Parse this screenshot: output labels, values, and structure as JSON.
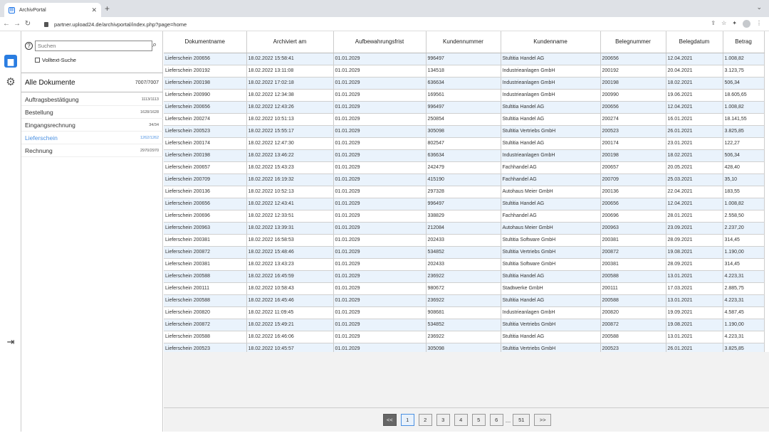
{
  "browser": {
    "tab_title": "ArchivPortal",
    "url": "partner.upload24.de/archivportal/index.php?page=home"
  },
  "sidebar": {
    "search_placeholder": "Suchen",
    "fulltext_label": "Volltext-Suche",
    "all": {
      "label": "Alle Dokumente",
      "count": "7007/7007"
    },
    "categories": [
      {
        "label": "Auftragsbestätigung",
        "count": "1113/1113"
      },
      {
        "label": "Bestellung",
        "count": "1628/1628"
      },
      {
        "label": "Eingangsrechnung",
        "count": "34/34"
      },
      {
        "label": "Lieferschein",
        "count": "1262/1262"
      },
      {
        "label": "Rechnung",
        "count": "2970/2970"
      }
    ]
  },
  "table": {
    "columns": [
      "Dokumentname",
      "Archiviert am",
      "Aufbewahrungsfrist",
      "Kundennummer",
      "Kundenname",
      "Belegnummer",
      "Belegdatum",
      "Betrag"
    ],
    "rows": [
      [
        "Lieferschein 200656",
        "18.02.2022 15:58:41",
        "01.01.2029",
        "996497",
        "Stultitia Handel AG",
        "200656",
        "12.04.2021",
        "1.008,82"
      ],
      [
        "Lieferschein 200192",
        "18.02.2022 13:11:08",
        "01.01.2029",
        "134518",
        "Industrieanlagen GmbH",
        "200192",
        "20.04.2021",
        "3.123,75"
      ],
      [
        "Lieferschein 200198",
        "18.02.2022 17:02:18",
        "01.01.2029",
        "636634",
        "Industrieanlagen GmbH",
        "200198",
        "18.02.2021",
        "506,34"
      ],
      [
        "Lieferschein 200990",
        "18.02.2022 12:34:38",
        "01.01.2029",
        "169561",
        "Industrieanlagen GmbH",
        "200990",
        "19.06.2021",
        "18.605,65"
      ],
      [
        "Lieferschein 200656",
        "18.02.2022 12:43:26",
        "01.01.2029",
        "996497",
        "Stultitia Handel AG",
        "200656",
        "12.04.2021",
        "1.008,82"
      ],
      [
        "Lieferschein 200274",
        "18.02.2022 10:51:13",
        "01.01.2029",
        "250854",
        "Stultitia Handel AG",
        "200274",
        "16.01.2021",
        "18.141,55"
      ],
      [
        "Lieferschein 200523",
        "18.02.2022 15:55:17",
        "01.01.2029",
        "305098",
        "Stultitia Vertriebs GmbH",
        "200523",
        "26.01.2021",
        "3.825,85"
      ],
      [
        "Lieferschein 200174",
        "18.02.2022 12:47:30",
        "01.01.2029",
        "802547",
        "Stultitia Handel AG",
        "200174",
        "23.01.2021",
        "122,27"
      ],
      [
        "Lieferschein 200198",
        "18.02.2022 13:46:22",
        "01.01.2029",
        "636634",
        "Industrieanlagen GmbH",
        "200198",
        "18.02.2021",
        "506,34"
      ],
      [
        "Lieferschein 200657",
        "18.02.2022 15:43:23",
        "01.01.2029",
        "242479",
        "Fachhandel AG",
        "200657",
        "20.05.2021",
        "428,40"
      ],
      [
        "Lieferschein 200709",
        "18.02.2022 16:19:32",
        "01.01.2029",
        "415190",
        "Fachhandel AG",
        "200709",
        "25.03.2021",
        "35,10"
      ],
      [
        "Lieferschein 200136",
        "18.02.2022 10:52:13",
        "01.01.2029",
        "297328",
        "Autohaus Meier GmbH",
        "200136",
        "22.04.2021",
        "183,55"
      ],
      [
        "Lieferschein 200656",
        "18.02.2022 12:43:41",
        "01.01.2029",
        "996497",
        "Stultitia Handel AG",
        "200656",
        "12.04.2021",
        "1.008,82"
      ],
      [
        "Lieferschein 200696",
        "18.02.2022 12:33:51",
        "01.01.2029",
        "338829",
        "Fachhandel AG",
        "200696",
        "28.01.2021",
        "2.558,50"
      ],
      [
        "Lieferschein 200963",
        "18.02.2022 13:39:31",
        "01.01.2029",
        "212084",
        "Autohaus Meier GmbH",
        "200963",
        "23.09.2021",
        "2.237,20"
      ],
      [
        "Lieferschein 200381",
        "18.02.2022 16:58:53",
        "01.01.2029",
        "202433",
        "Stultitia Software GmbH",
        "200381",
        "28.09.2021",
        "314,45"
      ],
      [
        "Lieferschein 200872",
        "18.02.2022 15:48:46",
        "01.01.2029",
        "534852",
        "Stultitia Vertriebs GmbH",
        "200872",
        "19.08.2021",
        "1.190,00"
      ],
      [
        "Lieferschein 200381",
        "18.02.2022 13:43:23",
        "01.01.2029",
        "202433",
        "Stultitia Software GmbH",
        "200381",
        "28.09.2021",
        "314,45"
      ],
      [
        "Lieferschein 200588",
        "18.02.2022 16:45:59",
        "01.01.2029",
        "236922",
        "Stultitia Handel AG",
        "200588",
        "13.01.2021",
        "4.223,31"
      ],
      [
        "Lieferschein 200111",
        "18.02.2022 10:58:43",
        "01.01.2029",
        "980672",
        "Stadtwerke GmbH",
        "200111",
        "17.03.2021",
        "2.885,75"
      ],
      [
        "Lieferschein 200588",
        "18.02.2022 16:45:46",
        "01.01.2029",
        "236922",
        "Stultitia Handel AG",
        "200588",
        "13.01.2021",
        "4.223,31"
      ],
      [
        "Lieferschein 200820",
        "18.02.2022 11:09:45",
        "01.01.2029",
        "908681",
        "Industrieanlagen GmbH",
        "200820",
        "19.09.2021",
        "4.587,45"
      ],
      [
        "Lieferschein 200872",
        "18.02.2022 15:49:21",
        "01.01.2029",
        "534852",
        "Stultitia Vertriebs GmbH",
        "200872",
        "19.08.2021",
        "1.190,00"
      ],
      [
        "Lieferschein 200588",
        "18.02.2022 16:46:06",
        "01.01.2029",
        "236922",
        "Stultitia Handel AG",
        "200588",
        "13.01.2021",
        "4.223,31"
      ],
      [
        "Lieferschein 200523",
        "18.02.2022 10:45:57",
        "01.01.2029",
        "305098",
        "Stultitia Vertriebs GmbH",
        "200523",
        "26.01.2021",
        "3.825,85"
      ]
    ]
  },
  "pagination": {
    "prev": "<<",
    "pages": [
      "1",
      "2",
      "3",
      "4",
      "5",
      "6"
    ],
    "ellipsis": "...",
    "last": "51",
    "next": ">>",
    "current": "1"
  }
}
